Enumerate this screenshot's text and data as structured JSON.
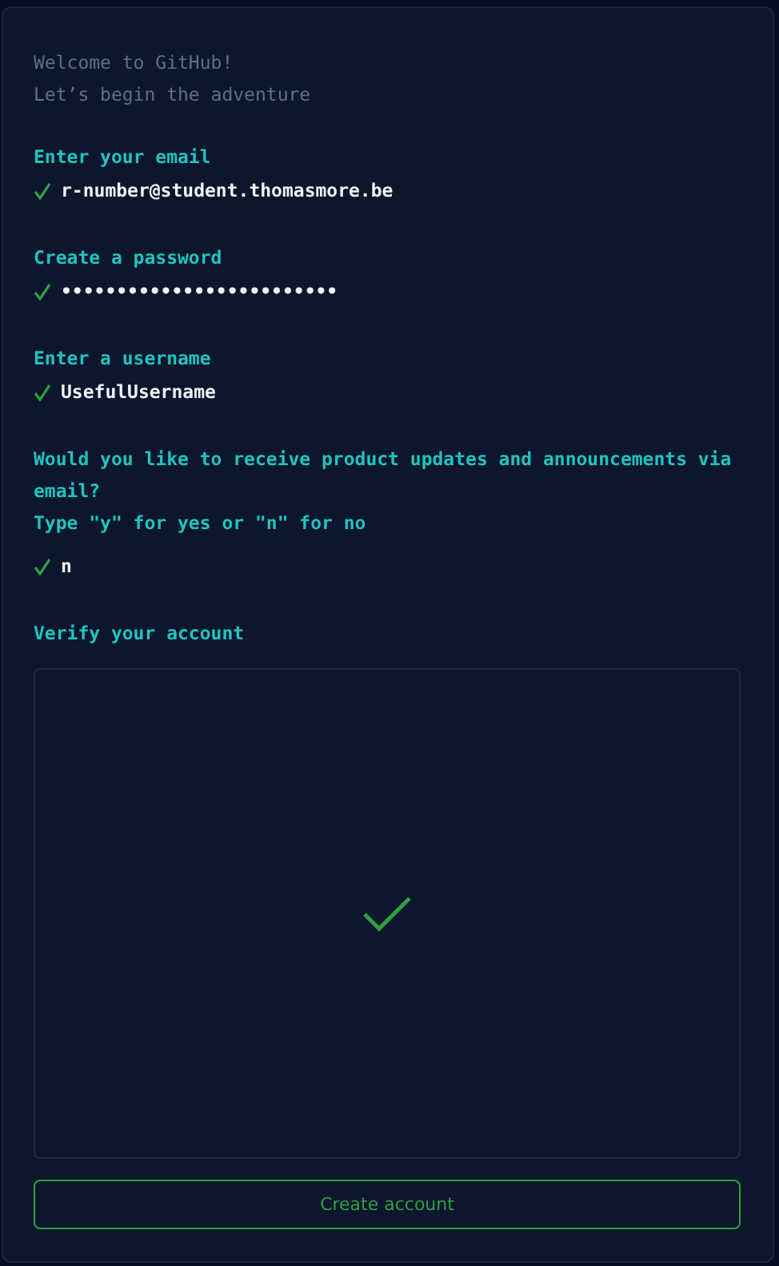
{
  "intro": [
    "Welcome to GitHub!",
    "Let’s begin the adventure"
  ],
  "steps": [
    {
      "label": "Enter your email",
      "value": "r-number@student.thomasmore.be",
      "done": true
    },
    {
      "label": "Create a password",
      "value": "•••••••••••••••••••••••••",
      "done": true
    },
    {
      "label": "Enter a username",
      "value": "UsefulUsername",
      "done": true
    },
    {
      "label": "Would you like to receive product updates and announcements via email?",
      "hint": "Type \"y\" for yes or \"n\" for no",
      "value": "n",
      "done": true
    }
  ],
  "verify": {
    "label": "Verify your account",
    "verified": true
  },
  "submit": {
    "label": "Create account"
  }
}
